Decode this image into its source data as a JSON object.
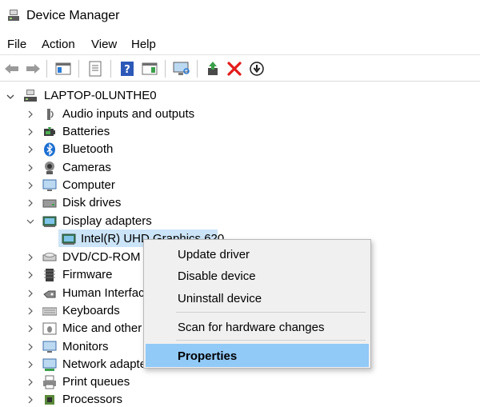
{
  "window": {
    "title": "Device Manager"
  },
  "menu": [
    "File",
    "Action",
    "View",
    "Help"
  ],
  "toolbar": {
    "icons": [
      "back-arrow-icon",
      "forward-arrow-icon",
      "show-hide-console-tree-icon",
      "properties-icon",
      "help-icon",
      "action-pane-icon",
      "scan-hardware-icon",
      "update-driver-icon",
      "uninstall-icon",
      "disable-device-icon"
    ]
  },
  "tree": {
    "root": "LAPTOP-0LUNTHE0",
    "categories": [
      {
        "label": "Audio inputs and outputs",
        "icon": "speaker-icon"
      },
      {
        "label": "Batteries",
        "icon": "battery-icon"
      },
      {
        "label": "Bluetooth",
        "icon": "bluetooth-icon"
      },
      {
        "label": "Cameras",
        "icon": "camera-icon"
      },
      {
        "label": "Computer",
        "icon": "monitor-icon"
      },
      {
        "label": "Disk drives",
        "icon": "disk-icon"
      },
      {
        "label": "Display adapters",
        "icon": "display-adapter-icon",
        "expanded": true
      },
      {
        "label": "Intel(R) UHD Graphics 620",
        "icon": "display-adapter-icon",
        "child": true,
        "selected": true
      },
      {
        "label": "DVD/CD-ROM drives",
        "icon": "dvd-icon"
      },
      {
        "label": "Firmware",
        "icon": "chip-icon"
      },
      {
        "label": "Human Interface Devices",
        "icon": "hid-icon"
      },
      {
        "label": "Keyboards",
        "icon": "keyboard-icon"
      },
      {
        "label": "Mice and other pointing devices",
        "icon": "mouse-icon"
      },
      {
        "label": "Monitors",
        "icon": "monitor-icon"
      },
      {
        "label": "Network adapters",
        "icon": "network-icon"
      },
      {
        "label": "Print queues",
        "icon": "printer-icon"
      },
      {
        "label": "Processors",
        "icon": "chip-icon"
      }
    ]
  },
  "context_menu": {
    "items": [
      "Update driver",
      "Disable device",
      "Uninstall device",
      "Scan for hardware changes",
      "Properties"
    ],
    "highlighted": "Properties"
  },
  "colors": {
    "selection": "#cce4f7",
    "menu_highlight": "#91c9f7",
    "menu_bg": "#f0f0f0"
  }
}
